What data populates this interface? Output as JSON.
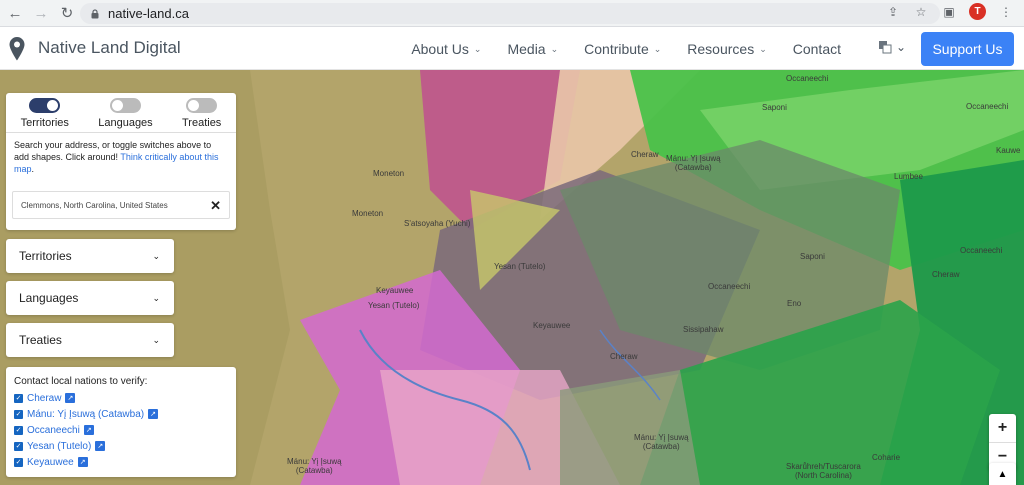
{
  "browser": {
    "url": "native-land.ca",
    "avatar_letter": "T"
  },
  "header": {
    "site_title": "Native Land Digital",
    "menu": [
      {
        "label": "About Us",
        "has_dropdown": true
      },
      {
        "label": "Media",
        "has_dropdown": true
      },
      {
        "label": "Contribute",
        "has_dropdown": true
      },
      {
        "label": "Resources",
        "has_dropdown": true
      },
      {
        "label": "Contact",
        "has_dropdown": false
      }
    ],
    "support_label": "Support Us",
    "colors": {
      "support": "#3b82f6",
      "text": "#4a5560"
    }
  },
  "toggles": [
    {
      "label": "Territories",
      "on": true
    },
    {
      "label": "Languages",
      "on": false
    },
    {
      "label": "Treaties",
      "on": false
    }
  ],
  "help": {
    "text": "Search your address, or toggle switches above to add shapes. Click around!",
    "link": "Think critically about this map",
    "suffix": "."
  },
  "search": {
    "value": "Clemmons, North Carolina, United States",
    "clear_symbol": "✕"
  },
  "accordions": [
    {
      "label": "Territories"
    },
    {
      "label": "Languages"
    },
    {
      "label": "Treaties"
    }
  ],
  "contact": {
    "title": "Contact local nations to verify:",
    "nations": [
      {
        "label": "Cheraw",
        "checked": true
      },
      {
        "label": "Mánu: Yį Įsuwą (Catawba)",
        "checked": true
      },
      {
        "label": "Occaneechi",
        "checked": true
      },
      {
        "label": "Yesan (Tutelo)",
        "checked": true
      },
      {
        "label": "Keyauwee",
        "checked": true
      }
    ]
  },
  "zoom": {
    "in": "+",
    "out": "−"
  },
  "map_labels": [
    {
      "text": "Occaneechi"
    },
    {
      "text": "Saponi"
    },
    {
      "text": "Occaneechi"
    },
    {
      "text": "Cheraw"
    },
    {
      "text": "Mánu: Yį Įsuwą\n(Catawba)"
    },
    {
      "text": "Kauwe"
    },
    {
      "text": "Moneton"
    },
    {
      "text": "Lumbee"
    },
    {
      "text": "Moneton"
    },
    {
      "text": "S'atsoyaha (Yuchi)"
    },
    {
      "text": "Saponi"
    },
    {
      "text": "Occaneechi"
    },
    {
      "text": "Yesan (Tutelo)"
    },
    {
      "text": "Cheraw"
    },
    {
      "text": "Keyauwee"
    },
    {
      "text": "Occaneechi"
    },
    {
      "text": "Yesan (Tutelo)"
    },
    {
      "text": "Eno"
    },
    {
      "text": "Keyauwee"
    },
    {
      "text": "Sissipahaw"
    },
    {
      "text": "Cheraw"
    },
    {
      "text": "Mánu: Yį Įsuwą\n(Catawba)"
    },
    {
      "text": "Mánu: Yį Įsuwą\n(Catawba)"
    },
    {
      "text": "Skarůhreh/Tuscarora\n(North Carolina)"
    },
    {
      "text": "Coharie"
    }
  ]
}
